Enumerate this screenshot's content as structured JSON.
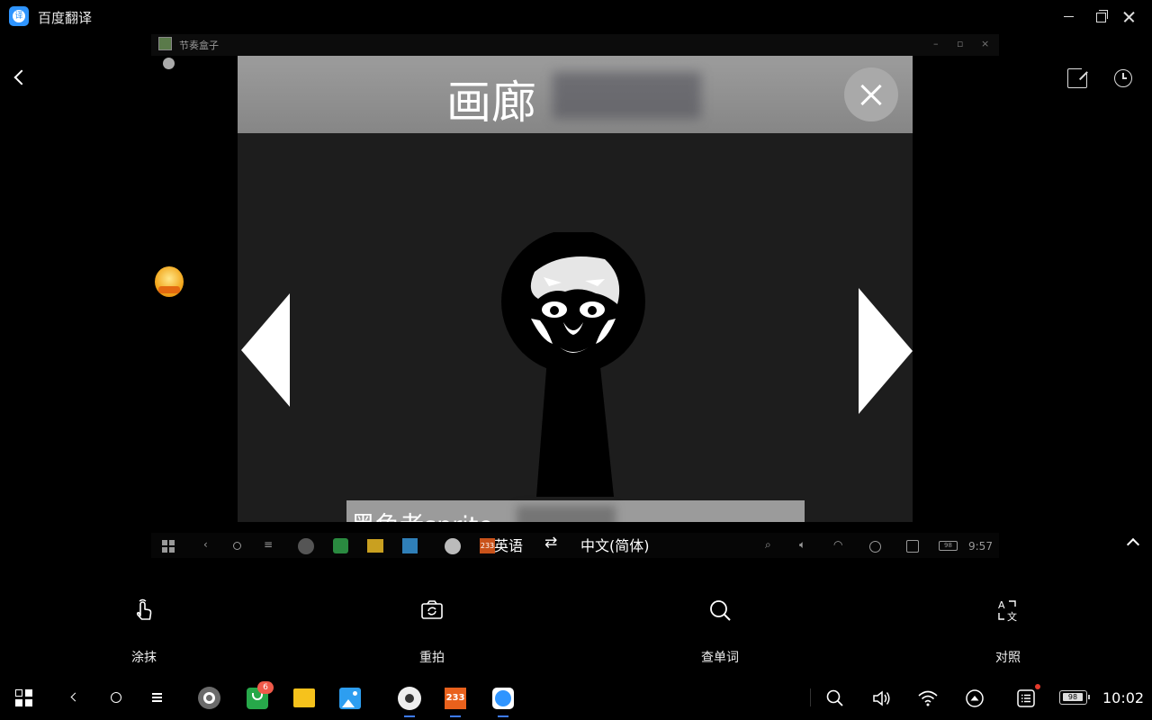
{
  "window": {
    "title": "百度翻译",
    "app_icon_glyph": "译"
  },
  "captured_window": {
    "title": "节奏盒子",
    "buttons": [
      "–",
      "▫",
      "×"
    ]
  },
  "game": {
    "title": "画廊",
    "caption": "黑色老snrite"
  },
  "captured_taskbar": {
    "clock": "9:57",
    "badge": "98",
    "app_badge": "233"
  },
  "language": {
    "source": "英语",
    "swap_glyph": "⇄",
    "target": "中文(简体)"
  },
  "tools": [
    {
      "label": "涂抹",
      "icon": "hand-pointer-icon"
    },
    {
      "label": "重拍",
      "icon": "camera-retake-icon"
    },
    {
      "label": "查单词",
      "icon": "search-icon"
    },
    {
      "label": "对照",
      "icon": "text-compare-icon"
    }
  ],
  "taskbar": {
    "clock": "10:02",
    "battery": "98",
    "app_badge_233": "233",
    "notification_count": "6"
  },
  "colors": {
    "accent": "#2f95ff",
    "background": "#000000"
  }
}
